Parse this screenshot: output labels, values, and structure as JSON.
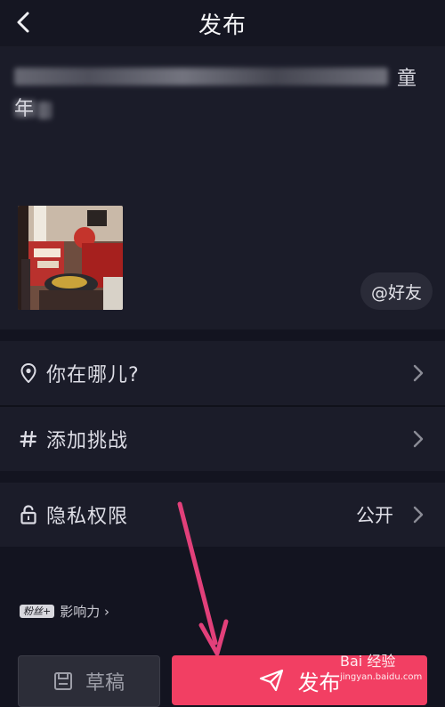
{
  "header": {
    "title": "发布",
    "back_icon": "chevron-left-icon"
  },
  "caption": {
    "line1_visible": "童",
    "line2_visible": "年"
  },
  "mention": {
    "label": "@好友"
  },
  "rows": {
    "location": {
      "label": "你在哪儿?",
      "icon": "location-pin-icon"
    },
    "challenge": {
      "label": "添加挑战",
      "icon": "hashtag-icon"
    },
    "privacy": {
      "label": "隐私权限",
      "value": "公开",
      "icon": "lock-open-icon"
    }
  },
  "influence": {
    "badge": "粉丝+",
    "label": "影响力 ›"
  },
  "buttons": {
    "draft": "草稿",
    "publish": "发布"
  },
  "watermark": {
    "brand": "Bai 经验",
    "url": "jingyan.baidu.com"
  },
  "colors": {
    "background": "#131420",
    "panel": "#1b1c29",
    "accent": "#f23f63",
    "annotation_arrow": "#e2407a"
  }
}
